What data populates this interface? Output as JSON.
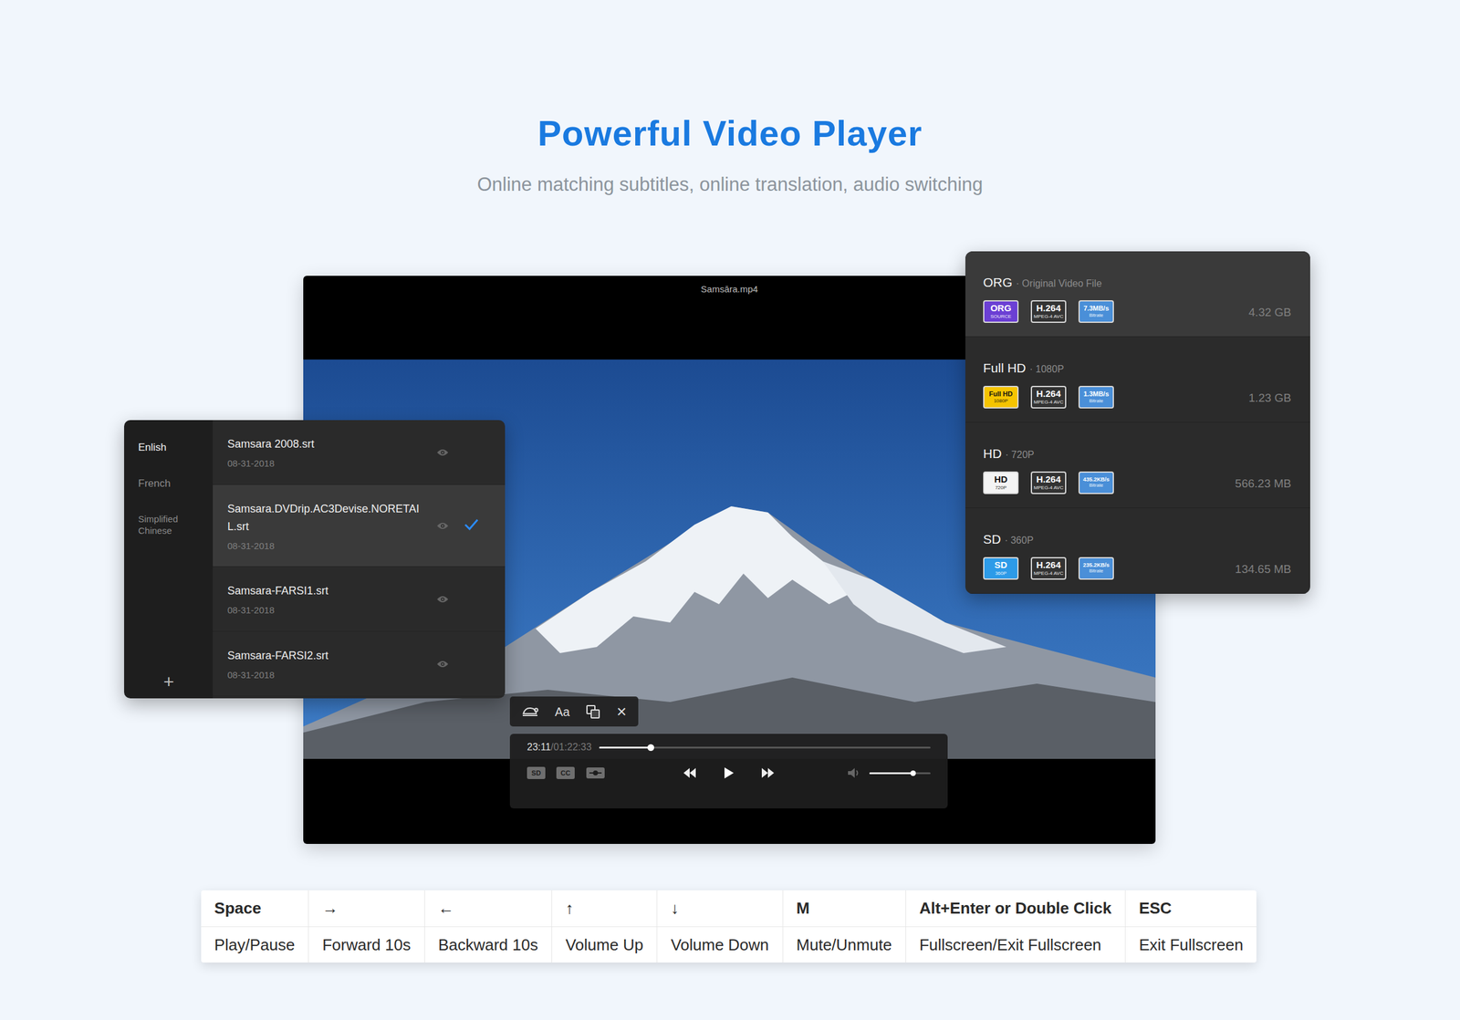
{
  "header": {
    "title": "Powerful Video Player",
    "subtitle": "Online matching subtitles, online translation, audio switching"
  },
  "player": {
    "title": "Samsāra.mp4",
    "toolbar": {
      "font": "Aa",
      "close": "×"
    },
    "time_current": "23:11",
    "time_total": "/01:22:33",
    "progress": 0.155,
    "buttons": [
      "SD",
      "CC"
    ],
    "volume": 0.71
  },
  "subtitles": {
    "languages": [
      {
        "label": "Enlish",
        "selected": true
      },
      {
        "label": "French",
        "selected": false
      },
      {
        "label": "Simplified Chinese",
        "selected": false
      }
    ],
    "add": "+",
    "files": [
      {
        "name": "Samsara 2008.srt",
        "date": "08-31-2018",
        "selected": false
      },
      {
        "name": "Samsara.DVDrip.AC3Devise.NORETAIL.srt",
        "date": "08-31-2018",
        "selected": true
      },
      {
        "name": "Samsara-FARSI1.srt",
        "date": "08-31-2018",
        "selected": false
      },
      {
        "name": "Samsara-FARSI2.srt",
        "date": "08-31-2018",
        "selected": false
      }
    ]
  },
  "qualities": [
    {
      "name": "ORG",
      "detail": "· Original Video File",
      "size": "4.32 GB",
      "selected": true,
      "badges": [
        {
          "top": "ORG",
          "bottom": "SOURCE",
          "color": "#6b3fd4"
        },
        {
          "top": "H.264",
          "bottom": "MPEG-4 AVC",
          "color": "#333333"
        },
        {
          "top": "7.3MB/s",
          "bottom": "Bitrate",
          "color": "#4a8fd8"
        }
      ]
    },
    {
      "name": "Full HD",
      "detail": "· 1080P",
      "size": "1.23 GB",
      "selected": false,
      "badges": [
        {
          "top": "Full HD",
          "bottom": "1080P",
          "color": "#f5c400"
        },
        {
          "top": "H.264",
          "bottom": "MPEG-4 AVC",
          "color": "#333333"
        },
        {
          "top": "1.3MB/s",
          "bottom": "Bitrate",
          "color": "#4a8fd8"
        }
      ]
    },
    {
      "name": "HD",
      "detail": "· 720P",
      "size": "566.23 MB",
      "selected": false,
      "badges": [
        {
          "top": "HD",
          "bottom": "720P",
          "color": "#f4f4f4"
        },
        {
          "top": "H.264",
          "bottom": "MPEG-4 AVC",
          "color": "#333333"
        },
        {
          "top": "435.2KB/s",
          "bottom": "Bitrate",
          "color": "#4a8fd8"
        }
      ]
    },
    {
      "name": "SD",
      "detail": "· 360P",
      "size": "134.65 MB",
      "selected": false,
      "badges": [
        {
          "top": "SD",
          "bottom": "360P",
          "color": "#2d9be8"
        },
        {
          "top": "H.264",
          "bottom": "MPEG-4 AVC",
          "color": "#333333"
        },
        {
          "top": "235.2KB/s",
          "bottom": "Bitrate",
          "color": "#4a8fd8"
        }
      ]
    }
  ],
  "shortcuts": [
    {
      "key": "Space",
      "action": "Play/Pause"
    },
    {
      "key": "→",
      "action": "Forward 10s"
    },
    {
      "key": "←",
      "action": "Backward 10s"
    },
    {
      "key": "↑",
      "action": "Volume Up"
    },
    {
      "key": "↓",
      "action": "Volume Down"
    },
    {
      "key": "M",
      "action": "Mute/Unmute"
    },
    {
      "key": "Alt+Enter or Double Click",
      "action": "Fullscreen/Exit Fullscreen"
    },
    {
      "key": "ESC",
      "action": "Exit Fullscreen"
    }
  ]
}
